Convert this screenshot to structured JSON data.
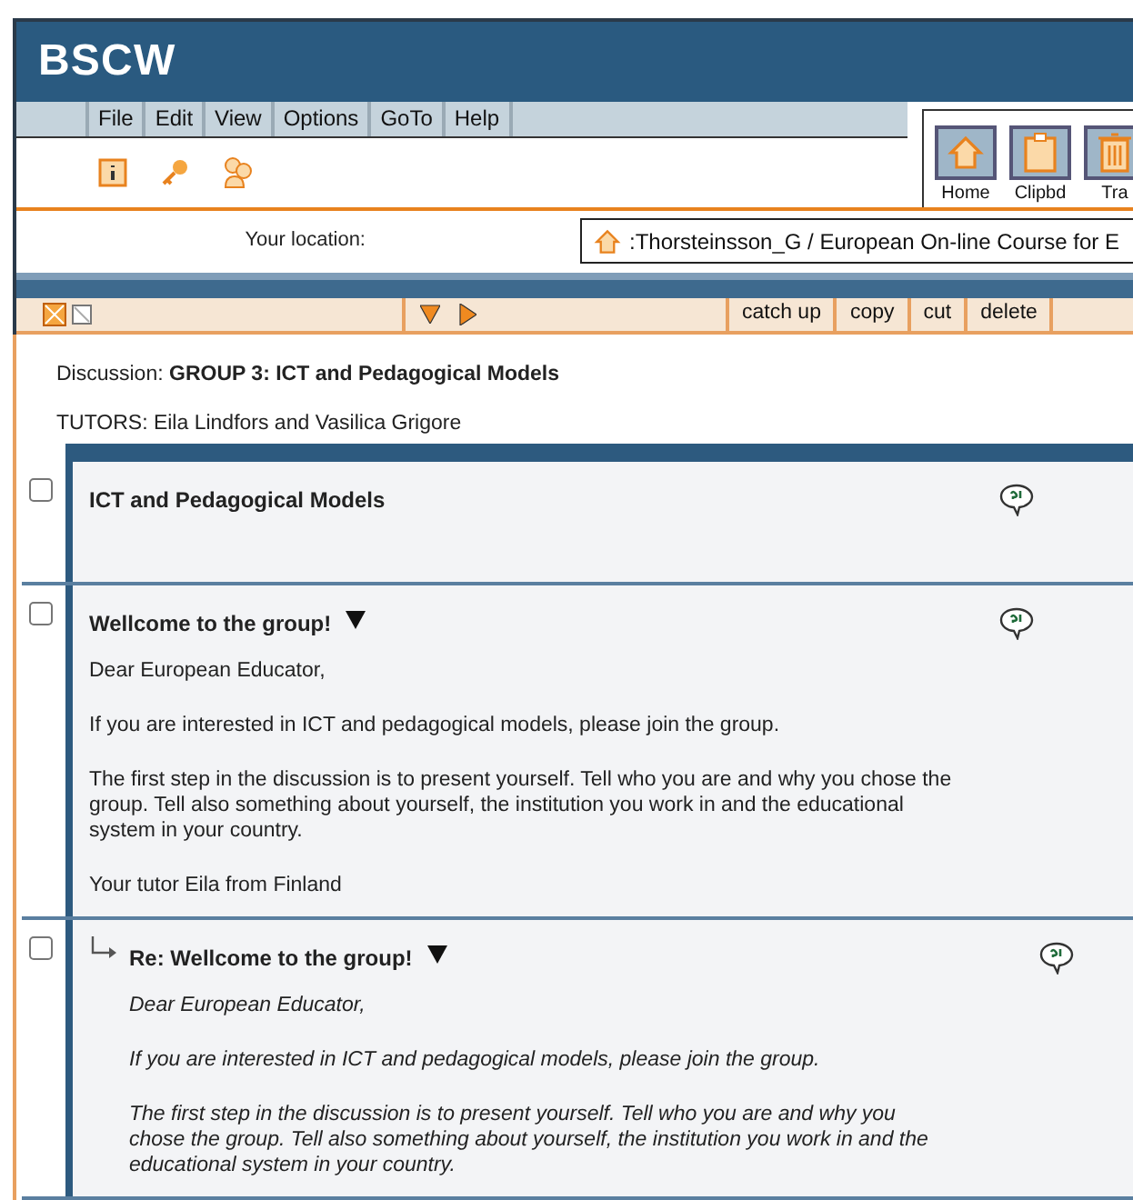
{
  "header": {
    "logo": "BSCW"
  },
  "menu": [
    "File",
    "Edit",
    "View",
    "Options",
    "GoTo",
    "Help"
  ],
  "nav_buttons": [
    {
      "label": "Home",
      "kind": "home"
    },
    {
      "label": "Clipbd",
      "kind": "clipboard"
    },
    {
      "label": "Tra",
      "kind": "trash"
    }
  ],
  "location": {
    "label": "Your location:",
    "path": ":Thorsteinsson_G / European On-line Course for E"
  },
  "actions": [
    "catch up",
    "copy",
    "cut",
    "delete"
  ],
  "discussion": {
    "label": "Discussion:",
    "title": "GROUP 3: ICT and Pedagogical Models",
    "tutors": "TUTORS: Eila Lindfors and Vasilica Grigore"
  },
  "posts": [
    {
      "title": "ICT and Pedagogical Models",
      "checked": false,
      "menu": false,
      "reply": false
    },
    {
      "title": "Wellcome to the group!",
      "checked": false,
      "menu": true,
      "reply": false,
      "body": [
        "Dear European Educator,",
        "If you are interested in ICT and pedagogical models, please join the group.",
        "The first step in the discussion is to present yourself. Tell who you are and why you chose the group. Tell also something about yourself, the institution you work in and the educational system in your country.",
        "Your tutor Eila from Finland"
      ]
    },
    {
      "title": "Re: Wellcome to the group!",
      "checked": false,
      "menu": true,
      "reply": true,
      "body": [
        "Dear European Educator,",
        "If you are interested in ICT and pedagogical models, please join the group.",
        "The first step in the discussion is to present yourself. Tell who you are and why you chose the group. Tell also something about yourself, the institution you work in and the educational system in your country."
      ]
    }
  ]
}
